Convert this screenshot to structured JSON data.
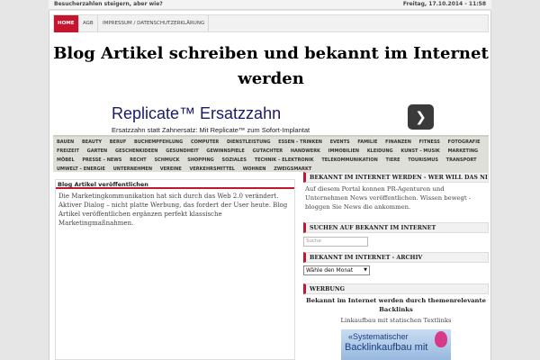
{
  "topbar": {
    "left": "Besucherzahlen steigern, aber wie?",
    "right": "Freitag, 17.10.2014 - 11:58"
  },
  "nav": {
    "items": [
      {
        "label": "HOME"
      },
      {
        "label": "AGB"
      },
      {
        "label": "IMPRESSUM / DATENSCHUTZERKLÄRUNG"
      }
    ]
  },
  "site_title": "Blog Artikel schreiben und bekannt im Internet werden",
  "ad": {
    "title": "Replicate™ Ersatzzahn",
    "text": "Ersatzzahn statt Zahnersatz: Mit Replicate™ zum Sofort-Implantat",
    "button_icon": "chevron-right-icon"
  },
  "categories": {
    "row1": [
      "BAUEN",
      "BEAUTY",
      "BERUF",
      "BUCHEMPFEHLUNG",
      "COMPUTER",
      "DIENSTLEISTUNG",
      "ESSEN – TRINKEN",
      "EVENTS",
      "FAMILIE",
      "FINANZEN",
      "FITNESS",
      "FOTOGRAFIE"
    ],
    "row2": [
      "FREIZEIT",
      "GARTEN",
      "GESCHENKIDEEN",
      "GESUNDHEIT",
      "GEWINNSPIELE",
      "GUTACHTER",
      "HANDWERK",
      "IMMOBILIEN",
      "KLEIDUNG",
      "KUNST – MUSIK",
      "MARKETING"
    ],
    "row3": [
      "MÖBEL",
      "PRESSE – NEWS",
      "RECHT",
      "SCHMUCK",
      "SHOPPING",
      "SOZIALES",
      "TECHNIK – ELEKTRONIK",
      "TELEKOMMUNIKATION",
      "TIERE",
      "TOURISMUS",
      "TRANSPORT"
    ],
    "row4": [
      "UMWELT – ENERGIE",
      "UNTERNEHMEN",
      "VEREINE",
      "VERKEHRSMITTEL",
      "WOHNEN",
      "ZWEIGSMARKT"
    ]
  },
  "main": {
    "heading": "Blog Artikel veröffentlichen",
    "body": "Die Marketingkommunikation hat sich durch das Web 2.0 verändert. Aktiver Dialog – nicht platte Werbung, das fordert der User heute. Blog Artikel veröffentlichen ergänzen perfekt klassische Marketingmaßnahmen."
  },
  "sidebar": {
    "w1_title": "BEKANNT IM INTERNET WERDEN - WER WILL DAS NICHT?",
    "w1_text": "Auf diesem Portal konnen PR-Agenturen und Unternehmen News veröffentlichen. Wissen bewegt - bloggen Sie News die ankommen.",
    "w2_title": "SUCHEN AUF BEKANNT IM INTERNET",
    "w2_placeholder": "Suche",
    "w3_title": "BEKANNT IM INTERNET - ARCHIV",
    "w3_select": "Wähle den Monat",
    "w4_title": "WERBUNG",
    "w4_bold": "Bekannt im Internet werden durch themenrelevante Backlinks",
    "w4_text": "Linkaufbau mit statischen Textlinks",
    "banner_line1": "«Systematischer",
    "banner_line2": "Backlinkaufbau mit"
  },
  "colors": {
    "accent": "#c71530",
    "nav_bg": "#f1f1f1",
    "cats_bg": "#dfdfd9"
  }
}
